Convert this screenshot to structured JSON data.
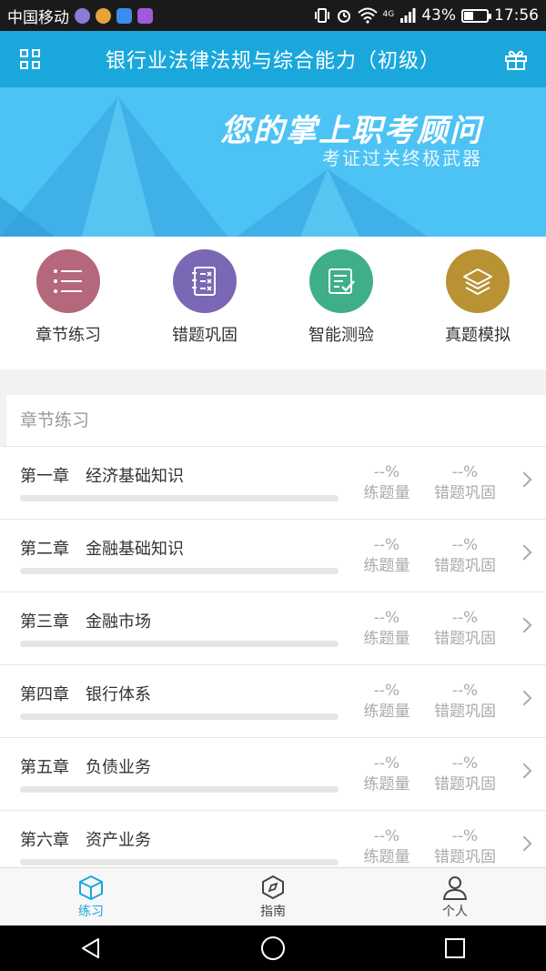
{
  "status_bar": {
    "carrier": "中国移动",
    "network": "4G",
    "battery": "43%",
    "battery_level": 0.43,
    "time": "17:56"
  },
  "header": {
    "title": "银行业法律法规与综合能力（初级）"
  },
  "banner": {
    "headline": "您的掌上职考顾问",
    "subline": "考证过关终极武器"
  },
  "quick_actions": [
    {
      "label": "章节练习",
      "icon": "list-icon",
      "color": "#b5677c"
    },
    {
      "label": "错题巩固",
      "icon": "wrong-questions-icon",
      "color": "#7a68b4"
    },
    {
      "label": "智能测验",
      "icon": "smart-test-icon",
      "color": "#3fae8b"
    },
    {
      "label": "真题模拟",
      "icon": "layers-icon",
      "color": "#b89233"
    }
  ],
  "chapter_section": {
    "title": "章节练习",
    "chapters": [
      {
        "name": "第一章　经济基础知识",
        "practice_value": "--%",
        "practice_label": "练题量",
        "review_value": "--%",
        "review_label": "错题巩固",
        "progress": 0
      },
      {
        "name": "第二章　金融基础知识",
        "practice_value": "--%",
        "practice_label": "练题量",
        "review_value": "--%",
        "review_label": "错题巩固",
        "progress": 0
      },
      {
        "name": "第三章　金融市场",
        "practice_value": "--%",
        "practice_label": "练题量",
        "review_value": "--%",
        "review_label": "错题巩固",
        "progress": 0
      },
      {
        "name": "第四章　银行体系",
        "practice_value": "--%",
        "practice_label": "练题量",
        "review_value": "--%",
        "review_label": "错题巩固",
        "progress": 0
      },
      {
        "name": "第五章　负债业务",
        "practice_value": "--%",
        "practice_label": "练题量",
        "review_value": "--%",
        "review_label": "错题巩固",
        "progress": 0
      },
      {
        "name": "第六章　资产业务",
        "practice_value": "--%",
        "practice_label": "练题量",
        "review_value": "--%",
        "review_label": "错题巩固",
        "progress": 0
      }
    ]
  },
  "bottom_nav": [
    {
      "label": "练习",
      "icon": "cube-icon",
      "active": true
    },
    {
      "label": "指南",
      "icon": "compass-icon",
      "active": false
    },
    {
      "label": "个人",
      "icon": "person-icon",
      "active": false
    }
  ],
  "colors": {
    "accent": "#1aa8dc",
    "banner": "#4cc3f4"
  }
}
